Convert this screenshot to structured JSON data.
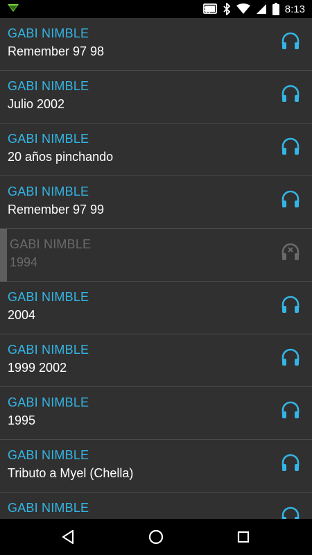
{
  "status_bar": {
    "time": "8:13",
    "icons": [
      "notification-arrow-icon",
      "cast-icon",
      "bluetooth-icon",
      "wifi-icon",
      "signal-icon",
      "battery-icon"
    ]
  },
  "colors": {
    "accent": "#33b5e5",
    "background": "#303030",
    "divider": "#4a4a4a",
    "disabled": "#6a6a6a"
  },
  "tracks": [
    {
      "artist": "GABI NIMBLE",
      "title": "Remember 97 98",
      "state": "available",
      "icon": "headphones-icon"
    },
    {
      "artist": "GABI NIMBLE",
      "title": "Julio 2002",
      "state": "available",
      "icon": "headphones-icon"
    },
    {
      "artist": "GABI NIMBLE",
      "title": "20 años pinchando",
      "state": "available",
      "icon": "headphones-icon"
    },
    {
      "artist": "GABI NIMBLE",
      "title": "Remember 97 99",
      "state": "available",
      "icon": "headphones-icon"
    },
    {
      "artist": "GABI NIMBLE",
      "title": "1994",
      "state": "unavailable",
      "icon": "headphones-unavailable-icon"
    },
    {
      "artist": "GABI NIMBLE",
      "title": "2004",
      "state": "available",
      "icon": "headphones-icon"
    },
    {
      "artist": "GABI NIMBLE",
      "title": "1999 2002",
      "state": "available",
      "icon": "headphones-icon"
    },
    {
      "artist": "GABI NIMBLE",
      "title": "1995",
      "state": "available",
      "icon": "headphones-icon"
    },
    {
      "artist": "GABI NIMBLE",
      "title": "Tributo a Myel (Chella)",
      "state": "available",
      "icon": "headphones-icon"
    },
    {
      "artist": "GABI NIMBLE",
      "title": "",
      "state": "available",
      "icon": "headphones-icon"
    }
  ],
  "nav_bar": {
    "buttons": [
      "back-icon",
      "home-icon",
      "recents-icon"
    ]
  }
}
